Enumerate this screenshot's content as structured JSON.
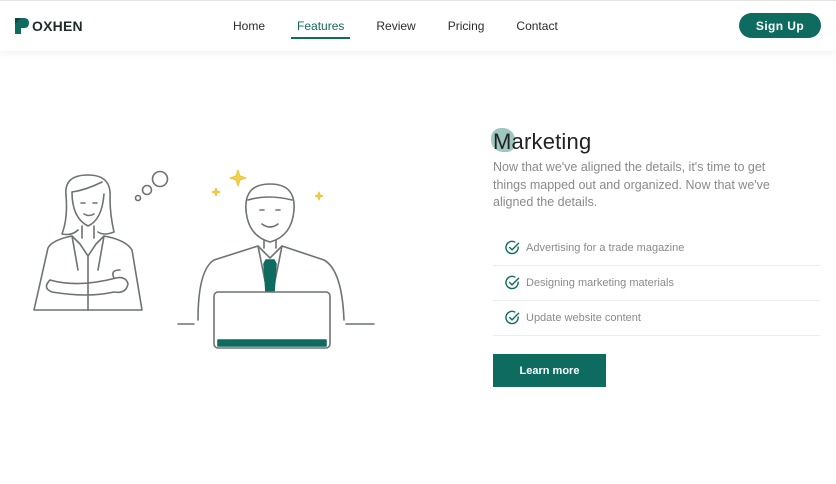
{
  "brand": {
    "name": "OXHEN",
    "mark": "logo-mark",
    "accent": "#0e6b5f"
  },
  "nav": {
    "items": [
      {
        "label": "Home",
        "active": false
      },
      {
        "label": "Features",
        "active": true
      },
      {
        "label": "Review",
        "active": false
      },
      {
        "label": "Pricing",
        "active": false
      },
      {
        "label": "Contact",
        "active": false
      }
    ],
    "signup_label": "Sign Up"
  },
  "feature": {
    "title": "Marketing",
    "description": "Now that we've aligned the details, it's time to get things mapped out and organized. Now that we've aligned the details.",
    "items": [
      {
        "label": "Advertising for a trade magazine",
        "icon": "check-circle-icon"
      },
      {
        "label": "Designing marketing materials",
        "icon": "check-circle-icon"
      },
      {
        "label": "Update website content",
        "icon": "check-circle-icon"
      }
    ],
    "cta_label": "Learn more"
  },
  "colors": {
    "primary": "#0e6b5f",
    "muted_text": "#8a8a8a",
    "sparkle": "#f1d24a"
  }
}
